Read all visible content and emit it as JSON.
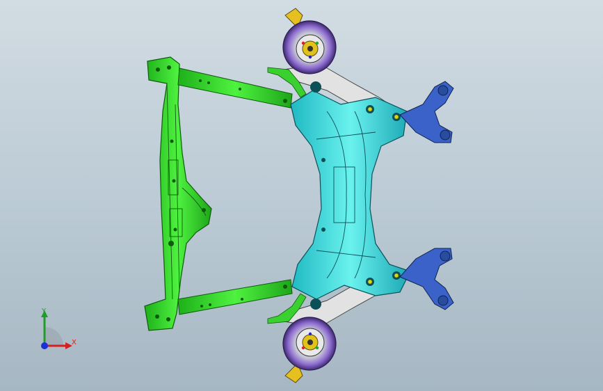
{
  "viewport": {
    "background_top": "#d2dce3",
    "background_bottom": "#a6b7c3"
  },
  "model": {
    "parts": [
      {
        "name": "front-crossmember",
        "color": "#2fdc23"
      },
      {
        "name": "left-tie-rod",
        "color": "#43c23c"
      },
      {
        "name": "right-tie-rod",
        "color": "#43c23c"
      },
      {
        "name": "subframe",
        "color": "#33d8d4"
      },
      {
        "name": "upper-control-arm-top",
        "color": "#d4d4d4"
      },
      {
        "name": "upper-control-arm-bottom",
        "color": "#d4d4d4"
      },
      {
        "name": "trailing-arm-top",
        "color": "#2a4ea8"
      },
      {
        "name": "trailing-arm-bottom",
        "color": "#2a4ea8"
      },
      {
        "name": "brake-disc-top",
        "color": "#7b5cc4"
      },
      {
        "name": "brake-disc-bottom",
        "color": "#7b5cc4"
      },
      {
        "name": "wheel-hub",
        "color": "#e0c21a"
      }
    ]
  },
  "triad": {
    "x_label": "X",
    "y_label": "Y",
    "x_color": "#d81f1f",
    "y_color": "#1f9d2a",
    "z_color": "#1c2fd8"
  }
}
